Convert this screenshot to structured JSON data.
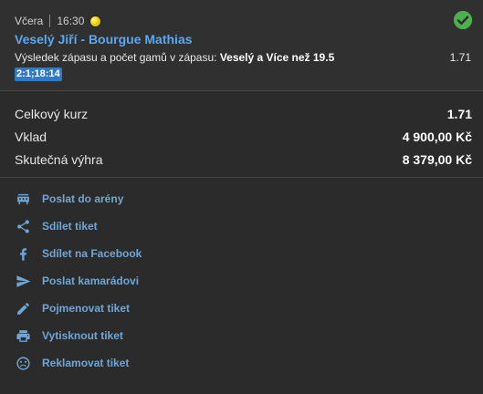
{
  "bet": {
    "day": "Včera",
    "time": "16:30",
    "sport_icon": "tennis-ball-icon",
    "status_icon": "check-circle-icon",
    "status_color": "#4caf50",
    "match": "Veselý Jiří - Bourgue Mathias",
    "market_label": "Výsledek zápasu a počet gamů v zápasu:",
    "selection": "Veselý a Více než 19.5",
    "odds": "1.71",
    "score": "2:1;18:14"
  },
  "totals": {
    "total_odds_label": "Celkový kurz",
    "total_odds_value": "1.71",
    "stake_label": "Vklad",
    "stake_value": "4 900,00 Kč",
    "win_label": "Skutečná výhra",
    "win_value": "8 379,00 Kč"
  },
  "actions": [
    {
      "label": "Poslat do arény",
      "icon": "arena-icon"
    },
    {
      "label": "Sdílet tiket",
      "icon": "share-icon"
    },
    {
      "label": "Sdílet na Facebook",
      "icon": "facebook-icon"
    },
    {
      "label": "Poslat kamarádovi",
      "icon": "send-icon"
    },
    {
      "label": "Pojmenovat tiket",
      "icon": "pencil-icon"
    },
    {
      "label": "Vytisknout tiket",
      "icon": "printer-icon"
    },
    {
      "label": "Reklamovat tiket",
      "icon": "sad-face-icon"
    }
  ],
  "colors": {
    "link": "#6ea6d6",
    "title": "#5aa8f0",
    "score_bg": "#2f79c9",
    "background": "#2b2b2b"
  }
}
